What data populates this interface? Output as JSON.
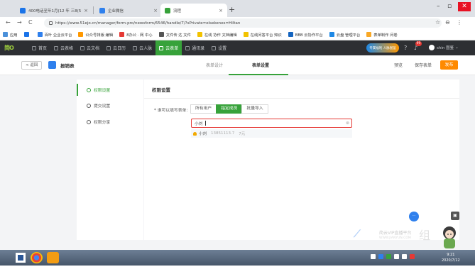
{
  "browser": {
    "tabs": [
      {
        "title": "400电话至年1月(12 年 三8(5)单Di",
        "active": false,
        "icon_color": "#1a73e8"
      },
      {
        "title": "企业微信",
        "active": false,
        "icon_color": "#2f80ed"
      },
      {
        "title": "流程",
        "active": true,
        "icon_color": "#37a23a"
      }
    ],
    "new_tab": "+",
    "window_controls": [
      "–",
      "▫",
      "✕"
    ],
    "url": "https://www.51ejo.cn/manager/form-pro/newsform/6546/handle/7/?sPrivate=elsekenes=Hiltan",
    "nav": {
      "back": "←",
      "forward": "→",
      "reload": "C"
    },
    "addr_icons": [
      "☆",
      "⊖",
      "⋮"
    ]
  },
  "bookmarks": [
    {
      "label": "应用",
      "color": "#4a90d9"
    },
    {
      "label": "",
      "color": "#1a73e8"
    },
    {
      "label": "百叶 企业云平台",
      "color": "#2f80ed"
    },
    {
      "label": "公众号排版 编辑",
      "color": "#ff9800"
    },
    {
      "label": "8办公 · 网 中心",
      "color": "#e53935"
    },
    {
      "label": "文件传 达 文件",
      "color": "#555555"
    },
    {
      "label": "在线 协作 文档编辑",
      "color": "#f2c200"
    },
    {
      "label": "在线问答平台 知识",
      "color": "#f2c200"
    },
    {
      "label": "BBB 云协作平台",
      "color": "#1565c0"
    },
    {
      "label": "云盘 管理平台",
      "color": "#1e88e5"
    },
    {
      "label": "表单制作 问卷",
      "color": "#f9a825"
    }
  ],
  "app_nav": {
    "logo": "简O",
    "items": [
      {
        "label": "首页",
        "active": false
      },
      {
        "label": "云表格",
        "active": false
      },
      {
        "label": "云文档",
        "active": false
      },
      {
        "label": "云日历",
        "active": false
      },
      {
        "label": "云人脉",
        "active": false
      },
      {
        "label": "云表单",
        "active": true
      },
      {
        "label": "通讯录",
        "active": false
      },
      {
        "label": "设置",
        "active": false
      }
    ],
    "promo": "专属福利 人脉图鉴",
    "badge": "99",
    "user_name": "shin 图鉴"
  },
  "form_header": {
    "back_label": "< 返回",
    "title": "报销表",
    "tabs": [
      {
        "label": "表单设计",
        "active": false
      },
      {
        "label": "表单设置",
        "active": true
      }
    ],
    "preview": "预览",
    "save": "保存表单",
    "publish": "发布"
  },
  "left_menu": [
    {
      "label": "权限设置",
      "active": true
    },
    {
      "label": "提交设置",
      "active": false
    },
    {
      "label": "权限分享",
      "active": false
    }
  ],
  "panel": {
    "title": "权限设置",
    "perm_label": "* 谁可以填写表单:",
    "segments": [
      {
        "label": "所有用户",
        "active": false
      },
      {
        "label": "指定成员",
        "active": true
      },
      {
        "label": "批量导入",
        "active": false
      }
    ],
    "input_value": "小刘",
    "input_clear": "⊗",
    "option": {
      "name": "小刘",
      "phone": "13851113.7",
      "dept": "7元"
    }
  },
  "floating": {
    "blue_button": "···",
    "camera": "▣",
    "watermark_title": "简云VIP直播平台",
    "watermark_sub": "WWW.JIANYUN.COM",
    "watermark_big": "组"
  },
  "taskbar": {
    "apps": [
      {
        "color": "#f39c12"
      },
      {
        "color": "#4a90d9"
      }
    ],
    "tray_colors": [
      "#ffffff",
      "#2f80ed",
      "#37a23a",
      "#ffffff",
      "#ffffff",
      "#e53935"
    ],
    "time": "9:21",
    "date": "2020/7/12"
  }
}
